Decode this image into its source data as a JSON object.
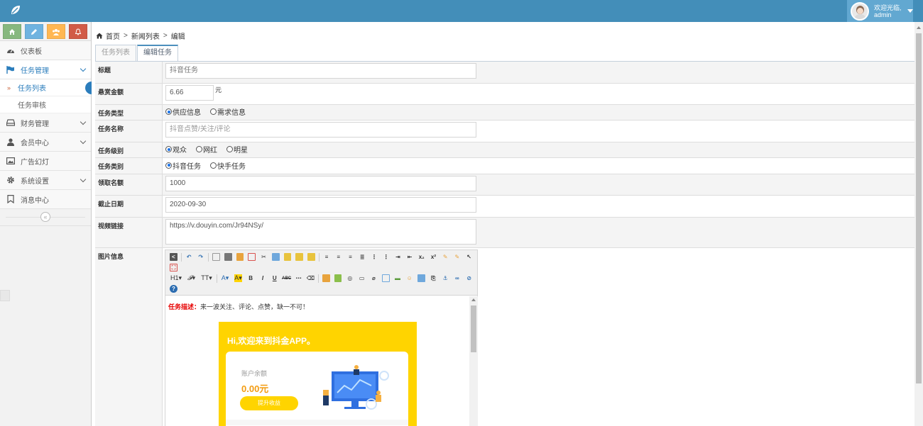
{
  "user": {
    "greeting": "欢迎光临,",
    "name": "admin"
  },
  "colors": {
    "topbar": "#438eb9",
    "accent": "#2b7dbc",
    "btn_green": "#87b87f",
    "btn_blue": "#6fb3e0",
    "btn_orange": "#ffb752",
    "btn_red": "#d15b47"
  },
  "sidebar": {
    "items": [
      {
        "label": "仪表板",
        "icon": "dashboard-icon"
      },
      {
        "label": "任务管理",
        "icon": "flag-icon"
      },
      {
        "label": "财务管理",
        "icon": "hdd-icon"
      },
      {
        "label": "会员中心",
        "icon": "user-icon"
      },
      {
        "label": "广告幻灯",
        "icon": "picture-icon"
      },
      {
        "label": "系统设置",
        "icon": "cog-icon"
      },
      {
        "label": "消息中心",
        "icon": "bookmark-icon"
      }
    ],
    "sub": [
      {
        "label": "任务列表"
      },
      {
        "label": "任务审核"
      }
    ]
  },
  "breadcrumb": {
    "home": "首页",
    "list": "新闻列表",
    "current": "编辑"
  },
  "tabs": [
    {
      "label": "任务列表"
    },
    {
      "label": "编辑任务"
    }
  ],
  "form": {
    "title": {
      "label": "标题",
      "value": "抖音任务"
    },
    "reward": {
      "label": "悬赏金额",
      "value": "6.66",
      "unit": "元"
    },
    "task_type": {
      "label": "任务类型",
      "options": [
        "供应信息",
        "需求信息"
      ]
    },
    "task_name": {
      "label": "任务名称",
      "placeholder": "抖音点赞/关注/评论"
    },
    "level": {
      "label": "任务级别",
      "options": [
        "观众",
        "网红",
        "明星"
      ]
    },
    "category": {
      "label": "任务类别",
      "options": [
        "抖音任务",
        "快手任务"
      ]
    },
    "quota": {
      "label": "领取名额",
      "value": "1000"
    },
    "deadline": {
      "label": "截止日期",
      "value": "2020-09-30"
    },
    "video": {
      "label": "视频链接",
      "value": "https://v.douyin.com/Jr94NSy/"
    },
    "images": {
      "label": "图片信息"
    }
  },
  "editor": {
    "desc_label": "任务描述：",
    "desc_text": "来一波关注、评论、点赞，缺一不可！",
    "card_title": "Hi,欢迎来到抖金APP。",
    "account_label": "账户余额",
    "account_value": "0.00元",
    "button_label": "提升收益"
  }
}
